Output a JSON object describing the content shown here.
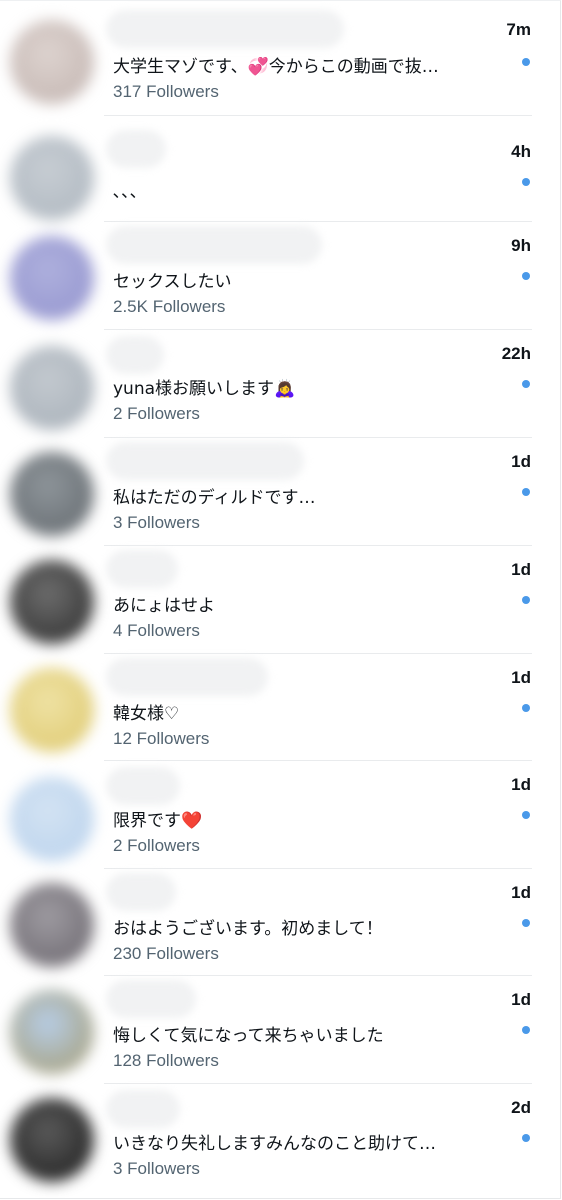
{
  "conversations": [
    {
      "time": "7m",
      "message": "大学生マゾです、💞今からこの動画で抜…",
      "followers": "317 Followers",
      "avatar_color": "#ddd3cf",
      "avatar_color2": "#c9bcb8"
    },
    {
      "time": "4h",
      "message": "､､､",
      "followers": "",
      "avatar_color": "#c7cdd3",
      "avatar_color2": "#b4bcc4"
    },
    {
      "time": "9h",
      "message": "セックスしたい",
      "followers": "2.5K Followers",
      "avatar_color": "#aeb0dd",
      "avatar_color2": "#9a9bd2"
    },
    {
      "time": "22h",
      "message": "yuna様お願いします🙇‍♀️",
      "followers": "2 Followers",
      "avatar_color": "#c3c9cf",
      "avatar_color2": "#aeb6be"
    },
    {
      "time": "1d",
      "message": "私はただのディルドです…",
      "followers": "3 Followers",
      "avatar_color": "#8e959a",
      "avatar_color2": "#6e7479"
    },
    {
      "time": "1d",
      "message": "あにょはせよ",
      "followers": "4 Followers",
      "avatar_color": "#6d6d6d",
      "avatar_color2": "#3d3d3d"
    },
    {
      "time": "1d",
      "message": "韓女様♡",
      "followers": "12 Followers",
      "avatar_color": "#efe2a4",
      "avatar_color2": "#e2cf7c"
    },
    {
      "time": "1d",
      "message": "限界です❤️",
      "followers": "2 Followers",
      "avatar_color": "#d3e3f3",
      "avatar_color2": "#c0d6ee"
    },
    {
      "time": "1d",
      "message": "おはようございます。初めまして！",
      "followers": "230 Followers",
      "avatar_color": "#9e9ba1",
      "avatar_color2": "#77737a"
    },
    {
      "time": "1d",
      "message": "悔しくて気になって来ちゃいました",
      "followers": "128 Followers",
      "avatar_color": "#b7cde6",
      "avatar_color2": "#a9a890"
    },
    {
      "time": "2d",
      "message": "いきなり失礼しますみんなのこと助けて…",
      "followers": "3 Followers",
      "avatar_color": "#5a5a5a",
      "avatar_color2": "#2c2c2c"
    }
  ],
  "unread_dot_color": "#4a99e9"
}
